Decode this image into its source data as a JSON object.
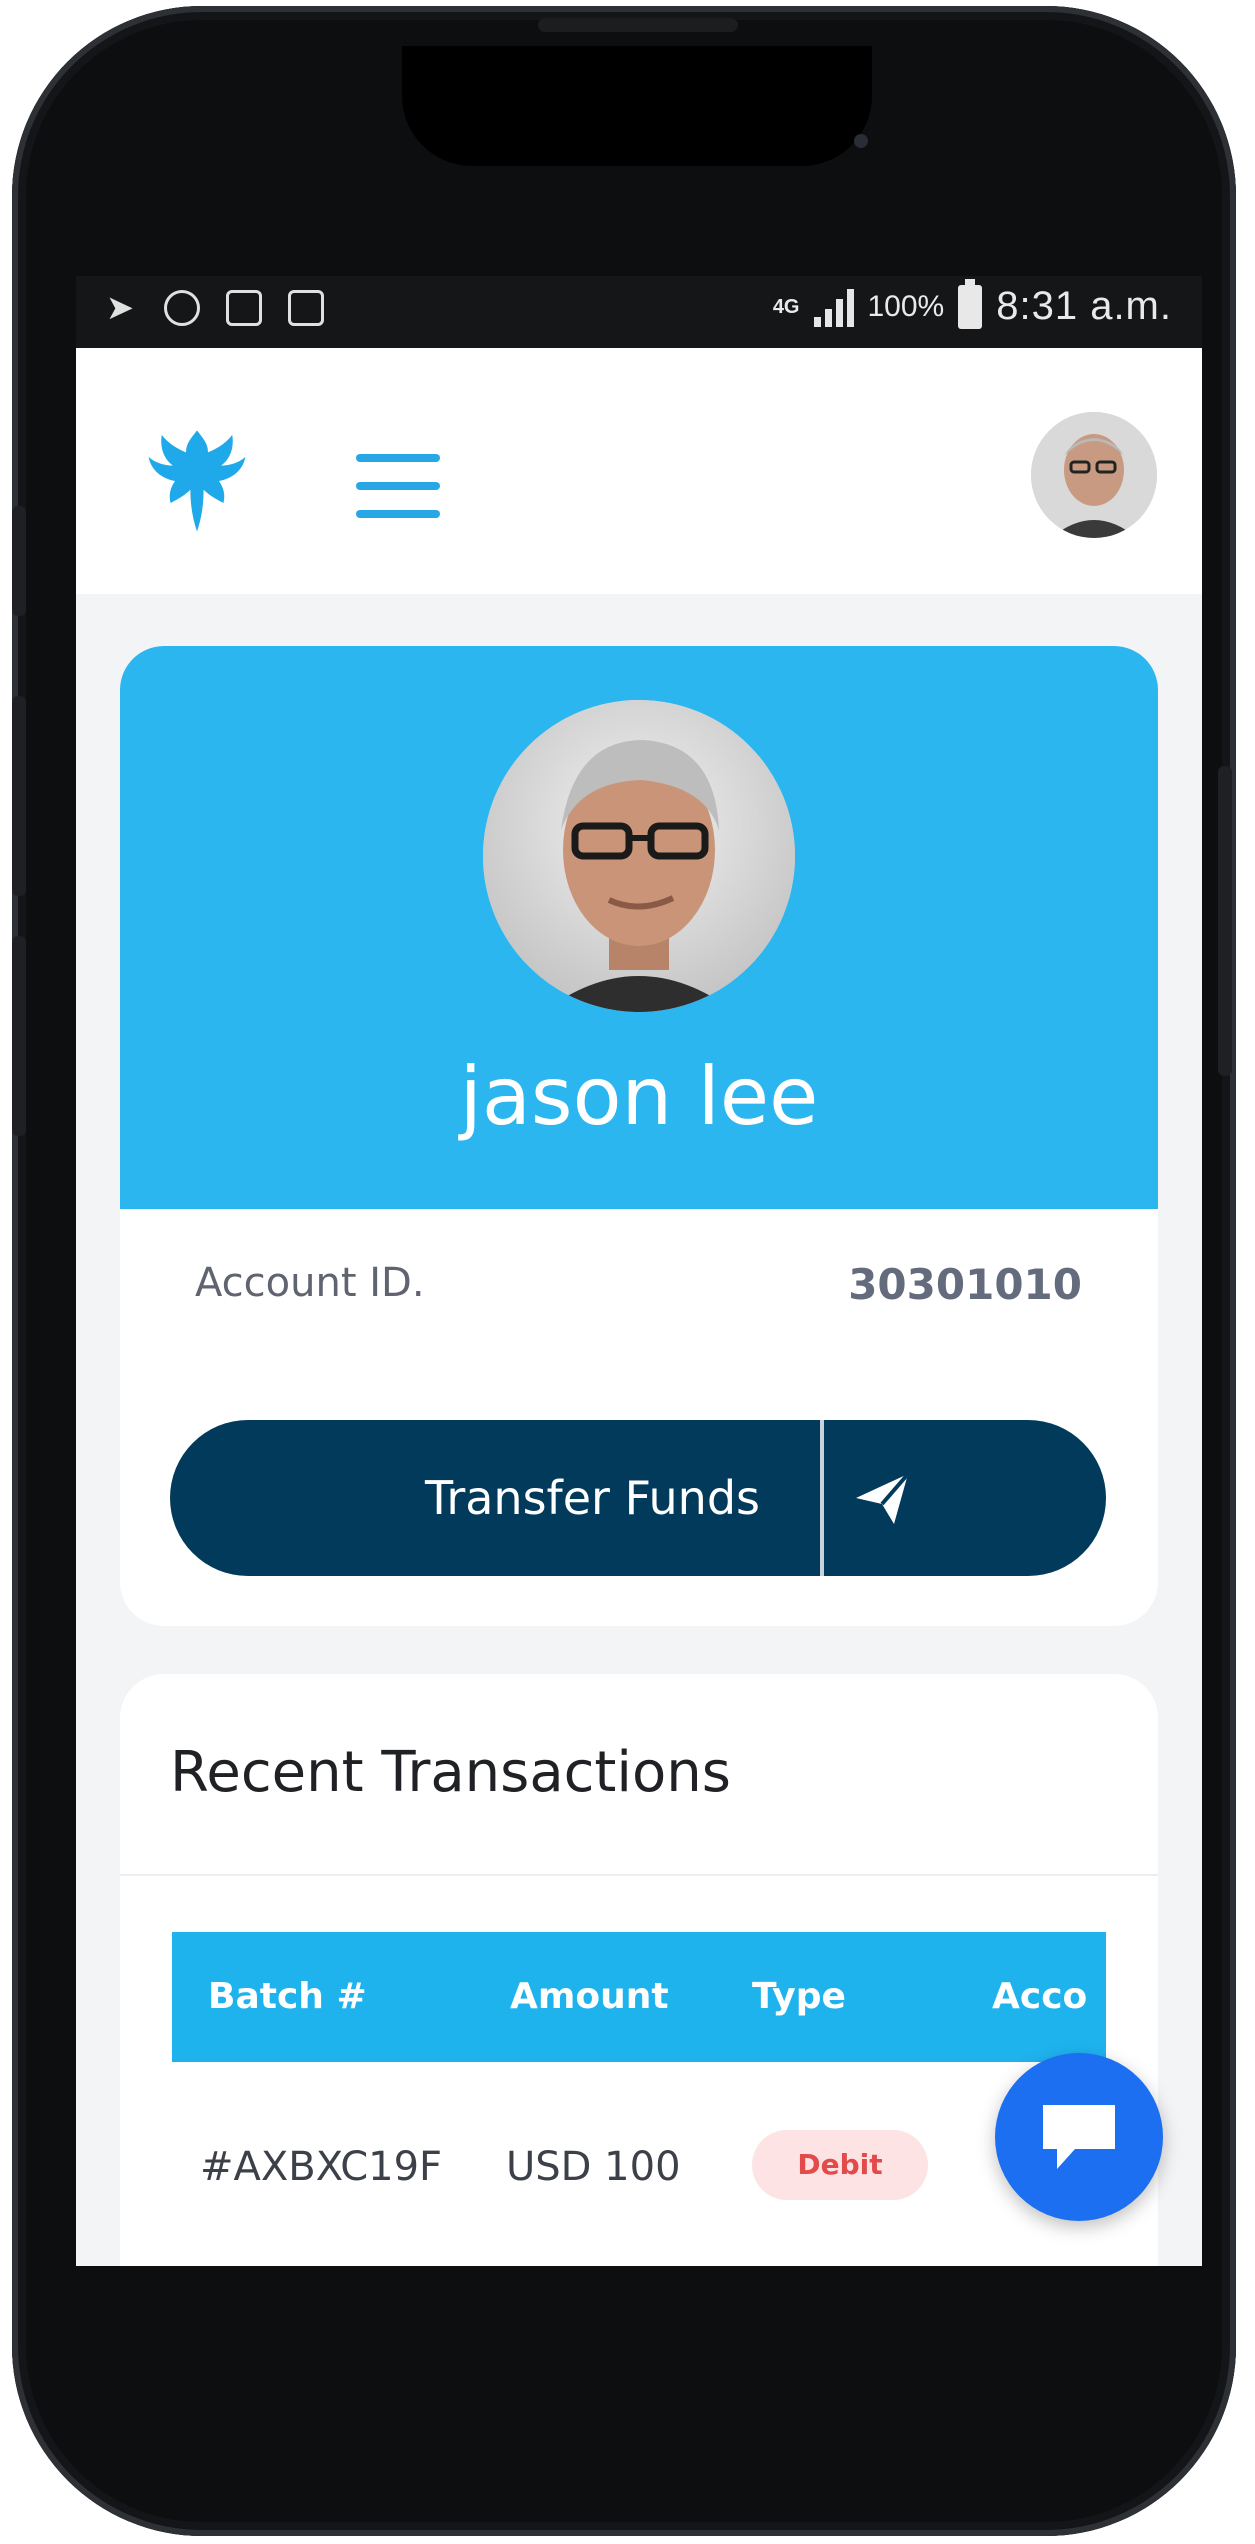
{
  "status_bar": {
    "network": "4G",
    "battery_percent": "100%",
    "time": "8:31 a.m."
  },
  "header": {
    "logo_icon": "eagle-logo",
    "menu_icon": "hamburger-menu-icon",
    "avatar_icon": "user-avatar"
  },
  "profile": {
    "name": "jason lee",
    "account_label": "Account ID.",
    "account_id": "30301010"
  },
  "actions": {
    "transfer_label": "Transfer Funds",
    "transfer_icon": "send-icon"
  },
  "transactions": {
    "title": "Recent Transactions",
    "columns": [
      "Batch #",
      "Amount",
      "Type",
      "Acco"
    ],
    "rows": [
      {
        "batch": "#AXBXC19F",
        "amount": "USD 100",
        "type": "Debit"
      }
    ]
  },
  "colors": {
    "accent": "#2cb6ef",
    "table_header": "#1fb3ee",
    "button_dark": "#023a5c",
    "debit_text": "#e34b4b",
    "debit_bg": "#fde3e3",
    "fab": "#1d6ff2"
  },
  "chat": {
    "icon": "chat-bubble-icon"
  }
}
